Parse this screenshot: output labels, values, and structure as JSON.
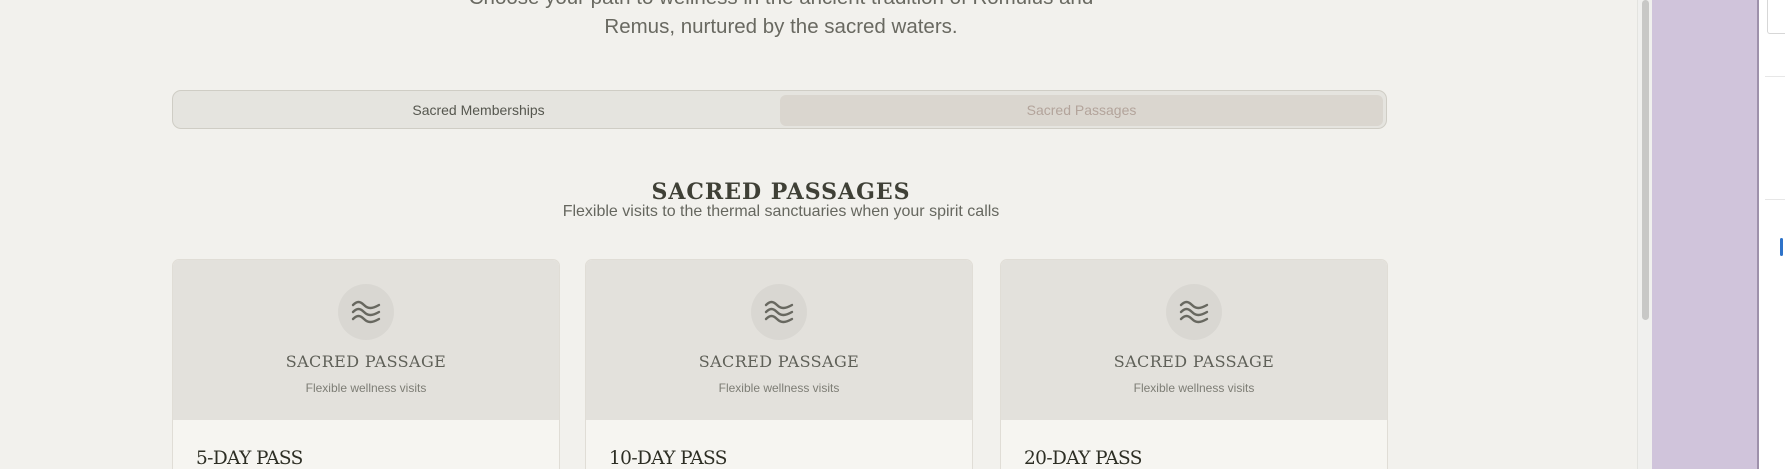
{
  "intro": {
    "line1": "Choose your path to wellness in the ancient tradition of Romulus and",
    "line2": "Remus, nurtured by the sacred waters."
  },
  "tabs": [
    {
      "label": "Sacred Memberships",
      "active": false
    },
    {
      "label": "Sacred Passages",
      "active": true
    }
  ],
  "section": {
    "title": "SACRED PASSAGES",
    "subtitle": "Flexible visits to the thermal sanctuaries when your spirit calls"
  },
  "cards": [
    {
      "icon": "waves-icon",
      "title": "SACRED PASSAGE",
      "subtitle": "Flexible wellness visits",
      "pass_name": "5-DAY PASS"
    },
    {
      "icon": "waves-icon",
      "title": "SACRED PASSAGE",
      "subtitle": "Flexible wellness visits",
      "pass_name": "10-DAY PASS"
    },
    {
      "icon": "waves-icon",
      "title": "SACRED PASSAGE",
      "subtitle": "Flexible wellness visits",
      "pass_name": "20-DAY PASS"
    }
  ],
  "colors": {
    "background": "#f2f1ed",
    "active_tab_text": "#b3a49b",
    "side_panel": "#d0c4db",
    "accent_blue": "#2e73c9"
  }
}
